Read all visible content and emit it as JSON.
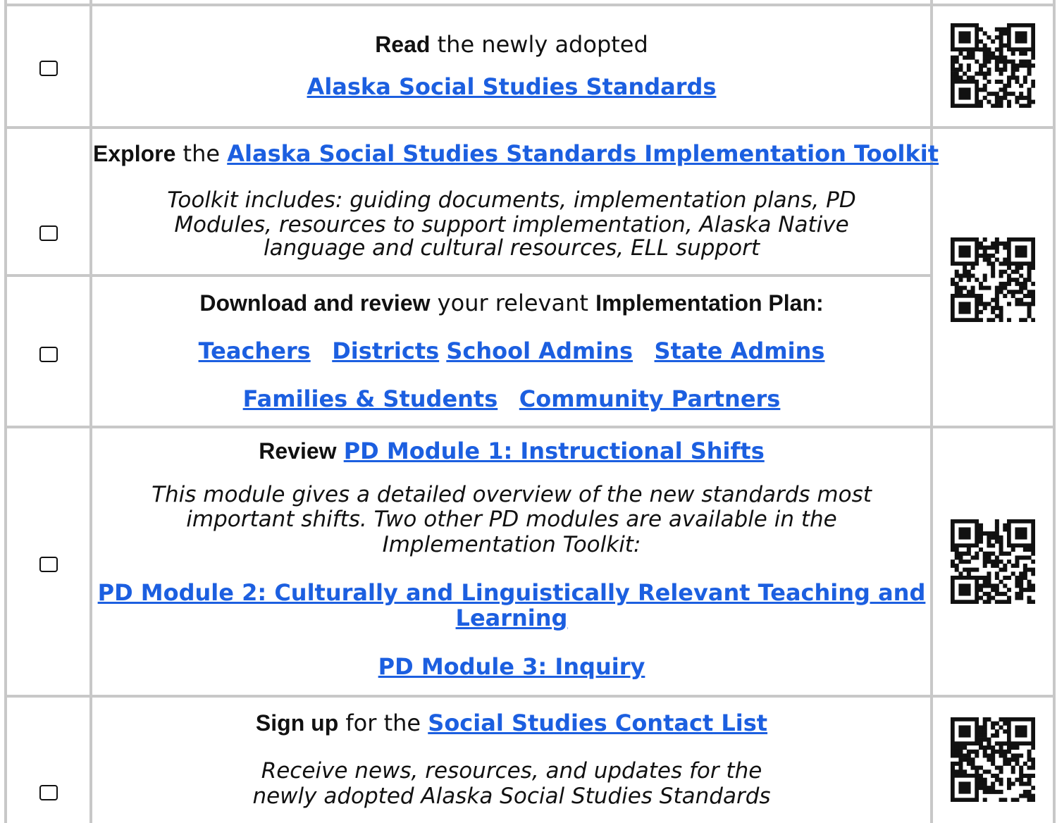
{
  "rows": [
    {
      "strong": "Read",
      "text": " the newly adopted",
      "link": "Alaska Social Studies Standards"
    },
    {
      "strong": "Explore",
      "text": " the ",
      "link": "Alaska Social Studies Standards Implementation Toolkit",
      "note_lines": [
        "Toolkit includes: guiding documents, implementation plans, PD",
        "Modules, resources to support implementation, Alaska Native",
        "language and cultural resources, ELL support"
      ]
    },
    {
      "strong": "Download and review",
      "text": " your relevant ",
      "strong2": "Implementation Plan:",
      "links_row1": [
        "Teachers",
        "Districts",
        "School Admins",
        "State Admins"
      ],
      "links_row2": [
        "Families & Students",
        "Community Partners"
      ]
    },
    {
      "strong": "Review",
      "link": "PD Module 1: Instructional Shifts",
      "note_lines": [
        "This module gives a detailed overview of the new standards most",
        "important shifts. Two other PD modules are available in the",
        "Implementation Toolkit:"
      ],
      "link2_lines": [
        "PD Module 2: Culturally and Linguistically Relevant Teaching and",
        "Learning"
      ],
      "link3": "PD Module 3: Inquiry"
    },
    {
      "strong": "Sign up",
      "text": " for the ",
      "link": "Social Studies Contact List",
      "note_lines": [
        "Receive news, resources, and updates for the",
        "newly adopted Alaska Social Studies Standards"
      ]
    }
  ],
  "colors": {
    "link": "#1c5fe0",
    "grid": "#c8c8c8"
  },
  "icons": [
    "checkbox-icon",
    "qr-code-icon"
  ]
}
